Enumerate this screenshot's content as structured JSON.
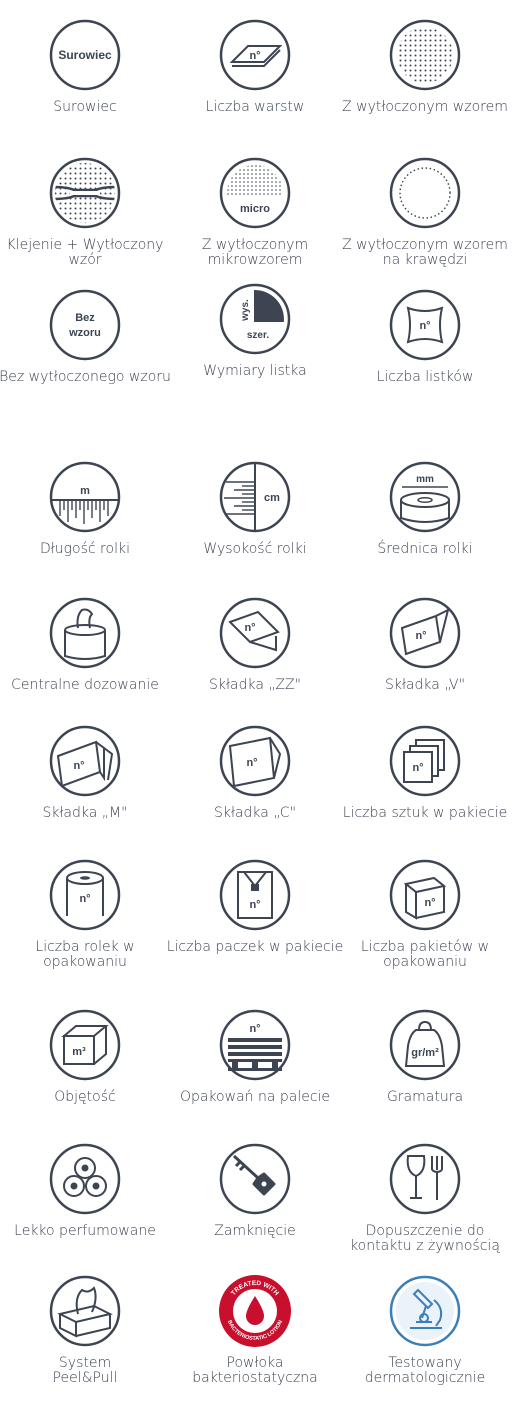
{
  "colors": {
    "icon": "#3d4452",
    "accent_red": "#c8102e",
    "accent_blue": "#3b7fb8"
  },
  "items": [
    {
      "icon": "surowiec-icon",
      "label": "Surowiec",
      "inner": "Surowiec"
    },
    {
      "icon": "layers-icon",
      "label": "Liczba warstw",
      "inner": "n°"
    },
    {
      "icon": "embossed-pattern-icon",
      "label": "Z wytłoczonym wzorem"
    },
    {
      "icon": "glue-emboss-icon",
      "label": "Klejenie + Wytłoczony wzór"
    },
    {
      "icon": "micro-emboss-icon",
      "label": "Z wytłoczonym mikrowzorem",
      "inner": "micro"
    },
    {
      "icon": "edge-emboss-icon",
      "label": "Z wytłoczonym wzorem na krawędzi"
    },
    {
      "icon": "no-pattern-icon",
      "label": "Bez wytłoczonego wzoru",
      "inner1": "Bez",
      "inner2": "wzoru"
    },
    {
      "icon": "sheet-size-icon",
      "label": "Wymiary listka",
      "inner1": "wys.",
      "inner2": "szer."
    },
    {
      "icon": "sheet-count-icon",
      "label": "Liczba listków",
      "inner": "n°"
    },
    {
      "icon": "roll-length-icon",
      "label": "Długość rolki",
      "inner": "m"
    },
    {
      "icon": "roll-height-icon",
      "label": "Wysokość rolki",
      "inner": "cm"
    },
    {
      "icon": "roll-diameter-icon",
      "label": "Średnica rolki",
      "inner": "mm"
    },
    {
      "icon": "center-feed-icon",
      "label": "Centralne dozowanie"
    },
    {
      "icon": "zz-fold-icon",
      "label": "Składka „ZZ\"",
      "inner": "n°"
    },
    {
      "icon": "v-fold-icon",
      "label": "Składka „V\"",
      "inner": "n°"
    },
    {
      "icon": "m-fold-icon",
      "label": "Składka „M\"",
      "inner": "n°"
    },
    {
      "icon": "c-fold-icon",
      "label": "Składka „C\"",
      "inner": "n°"
    },
    {
      "icon": "pack-count-icon",
      "label": "Liczba sztuk w pakiecie",
      "inner": "n°"
    },
    {
      "icon": "roll-count-icon",
      "label": "Liczba rolek w opakowaniu",
      "inner": "n°"
    },
    {
      "icon": "bundle-count-icon",
      "label": "Liczba paczek w pakiecie",
      "inner": "n°"
    },
    {
      "icon": "box-count-icon",
      "label": "Liczba pakietów w opakowaniu",
      "inner": "n°"
    },
    {
      "icon": "volume-icon",
      "label": "Objętość",
      "inner": "m³"
    },
    {
      "icon": "pallet-icon",
      "label": "Opakowań na palecie",
      "inner": "n°"
    },
    {
      "icon": "weight-icon",
      "label": "Gramatura",
      "inner": "gr/m²"
    },
    {
      "icon": "flower-icon",
      "label": "Lekko perfumowane"
    },
    {
      "icon": "key-icon",
      "label": "Zamknięcie"
    },
    {
      "icon": "food-contact-icon",
      "label": "Dopuszczenie do kontaktu z żywnością"
    },
    {
      "icon": "tissue-box-icon",
      "label": "System Peel&Pull"
    },
    {
      "icon": "bacteriostatic-icon",
      "label": "Powłoka bakteriostatyczna",
      "badge_top": "TREATED WITH",
      "badge_bottom": "BACTERIOSTATIC LOTION"
    },
    {
      "icon": "microscope-icon",
      "label": "Testowany dermatologicznie"
    }
  ]
}
